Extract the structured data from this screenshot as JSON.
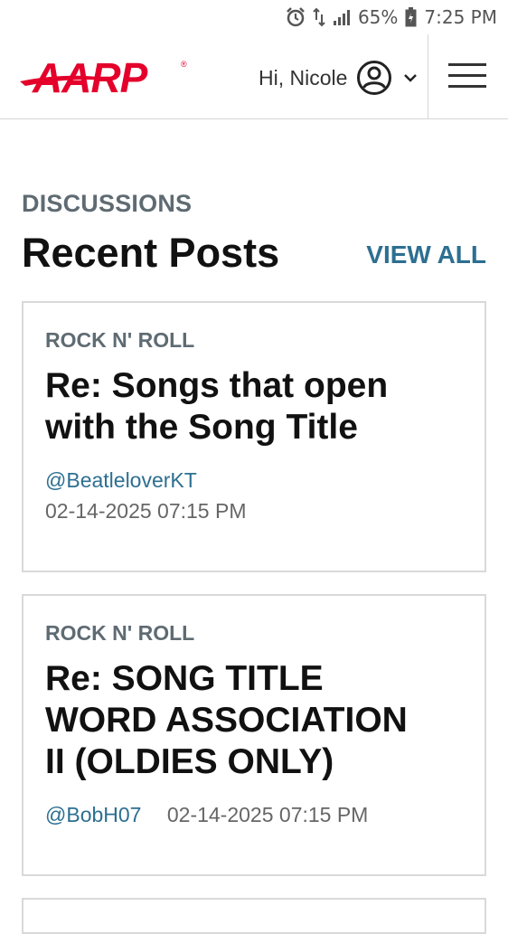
{
  "status_bar": {
    "battery": "65%",
    "time": "7:25 PM",
    "icons": [
      "alarm-icon",
      "data-transfer-icon",
      "signal-icon",
      "battery-icon"
    ]
  },
  "header": {
    "logo_text": "AARP",
    "greeting": "Hi, Nicole",
    "brand_color": "#e4002b"
  },
  "section": {
    "eyebrow": "DISCUSSIONS",
    "title": "Recent Posts",
    "view_all": "VIEW ALL"
  },
  "posts": [
    {
      "category": "ROCK N' ROLL",
      "title": "Re: Songs that open with the Song Title",
      "author": "@BeatleloverKT",
      "date": "02-14-2025 07:15 PM"
    },
    {
      "category": "ROCK N' ROLL",
      "title": "Re: SONG TITLE WORD ASSOCIATION II (OLDIES ONLY)",
      "author": "@BobH07",
      "date": "02-14-2025 07:15 PM"
    }
  ]
}
